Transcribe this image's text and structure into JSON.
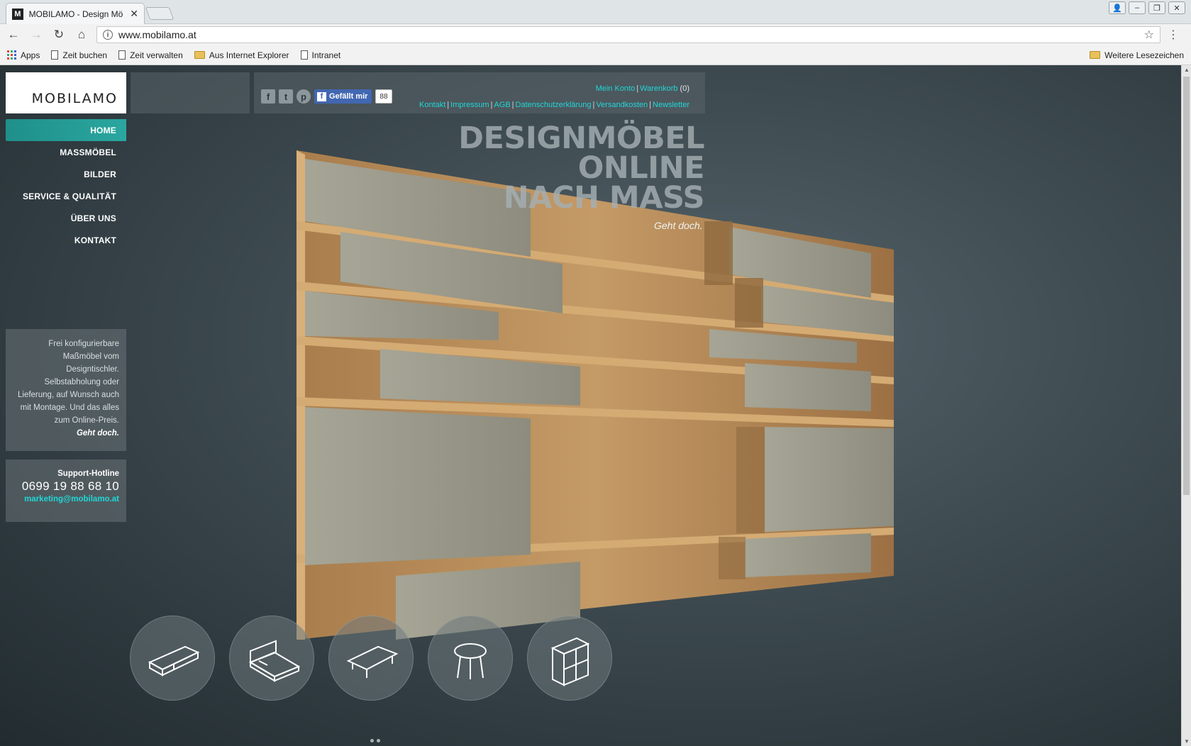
{
  "browser": {
    "tab_title": "MOBILAMO - Design Mö",
    "tab_favicon": "M",
    "url": "www.mobilamo.at",
    "bookmarks": [
      {
        "label": "Apps",
        "icon": "apps-icon"
      },
      {
        "label": "Zeit buchen",
        "icon": "page-icon"
      },
      {
        "label": "Zeit verwalten",
        "icon": "page-icon"
      },
      {
        "label": "Aus Internet Explorer",
        "icon": "folder-icon"
      },
      {
        "label": "Intranet",
        "icon": "page-icon"
      }
    ],
    "bookmarks_other": "Weitere Lesezeichen"
  },
  "site": {
    "logo": "MOBILAMO",
    "social": {
      "like_label": "Gefällt mir",
      "like_count": "88"
    },
    "account_links": {
      "account": "Mein Konto",
      "cart": "Warenkorb",
      "cart_count": "(0)"
    },
    "footer_links": [
      "Kontakt",
      "Impressum",
      "AGB",
      "Datenschutzerklärung",
      "Versandkosten",
      "Newsletter"
    ],
    "nav": [
      "HOME",
      "MASSMÖBEL",
      "BILDER",
      "SERVICE & QUALITÄT",
      "ÜBER UNS",
      "KONTAKT"
    ],
    "headline": [
      "DESIGNMÖBEL",
      "ONLINE",
      "NACH MASS"
    ],
    "tagline": "Geht doch.",
    "info_text": "Frei konfigurierbare Maßmöbel vom Designtischler. Selbstabholung oder Lieferung, auf Wunsch auch mit Montage. Und das alles zum Online-Preis.",
    "info_geht": "Geht doch.",
    "hotline_label": "Support-Hotline",
    "hotline_phone": "0699 19 88 68 10",
    "hotline_mail": "marketing@mobilamo.at",
    "categories": [
      "lowboard-icon",
      "bed-icon",
      "table-icon",
      "side-table-icon",
      "shelf-cube-icon"
    ]
  },
  "colors": {
    "accent": "#21d6d6",
    "nav_active": "#2aa7a0",
    "wood": "#b58a55",
    "panel": "#9c9a8b"
  }
}
